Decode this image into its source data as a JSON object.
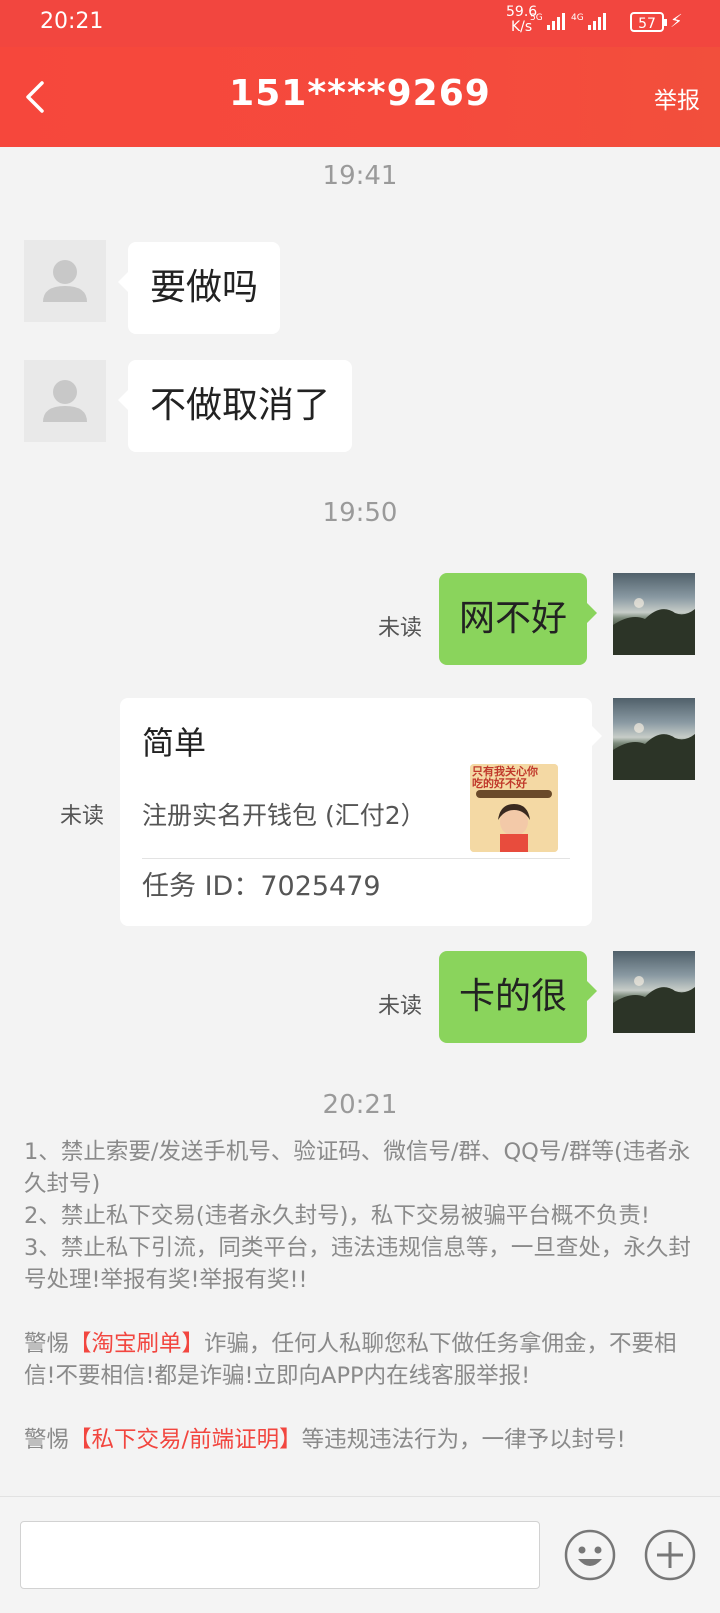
{
  "status_bar": {
    "time": "20:21",
    "net_speed": "59.6",
    "net_unit": "K/s",
    "signal1_label": "5G",
    "signal2_label": "4G",
    "battery": "57"
  },
  "header": {
    "title": "151****9269",
    "report_label": "举报"
  },
  "chat": {
    "timestamps": [
      "19:41",
      "19:50",
      "20:21"
    ],
    "messages": [
      {
        "text": "要做吗"
      },
      {
        "text": "不做取消了"
      },
      {
        "text": "网不好",
        "status": "未读"
      },
      {
        "text": "卡的很",
        "status": "未读"
      }
    ],
    "task_card": {
      "status": "未读",
      "title": "简单",
      "description": "注册实名开钱包 (汇付2）",
      "task_id": "任务 ID：7025479",
      "thumb_text_1": "只有我关心你",
      "thumb_text_2": "吃的好不好"
    }
  },
  "rules": {
    "line1": "1、禁止索要/发送手机号、验证码、微信号/群、QQ号/群等(违者永久封号)",
    "line2": "2、禁止私下交易(违者永久封号)，私下交易被骗平台概不负责!",
    "line3": "3、禁止私下引流，同类平台，违法违规信息等，一旦查处，永久封号处理!举报有奖!举报有奖!!",
    "warn1_prefix": "警惕",
    "warn1_highlight": "【淘宝刷单】",
    "warn1_rest": "诈骗，任何人私聊您私下做任务拿佣金，不要相信!不要相信!都是诈骗!立即向APP内在线客服举报!",
    "warn2_prefix": "警惕",
    "warn2_highlight": "【私下交易/前端证明】",
    "warn2_rest": "等违规违法行为，一律予以封号!"
  },
  "input": {
    "placeholder": ""
  },
  "colors": {
    "brand_red": "#f2463f",
    "bubble_green": "#8ad45c"
  }
}
